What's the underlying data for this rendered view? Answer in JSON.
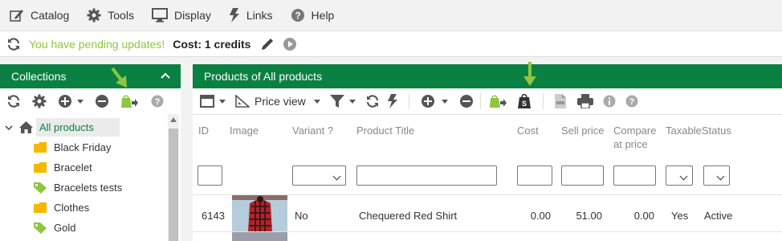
{
  "menu": {
    "catalog": "Catalog",
    "tools": "Tools",
    "display": "Display",
    "links": "Links",
    "help": "Help"
  },
  "update_bar": {
    "message": "You have pending updates!",
    "cost": "Cost: 1 credits"
  },
  "collections": {
    "title": "Collections",
    "items": [
      {
        "label": "All products",
        "icon": "home-icon"
      },
      {
        "label": "Black Friday",
        "icon": "folder-icon"
      },
      {
        "label": "Bracelet",
        "icon": "folder-icon"
      },
      {
        "label": "Bracelets tests",
        "icon": "tag-icon"
      },
      {
        "label": "Clothes",
        "icon": "folder-icon"
      },
      {
        "label": "Gold",
        "icon": "tag-icon"
      }
    ]
  },
  "products": {
    "title": "Products of All products",
    "price_view": "Price view",
    "columns": {
      "id": "ID",
      "image": "Image",
      "variant": "Variant ?",
      "title": "Product Title",
      "cost": "Cost",
      "sell_price": "Sell price",
      "compare_at_price_1": "Compare",
      "compare_at_price_2": "at price",
      "taxable": "Taxable",
      "status": "Status"
    },
    "rows": [
      {
        "id": "6143",
        "variant": "No",
        "title": "Chequered Red Shirt",
        "cost": "0.00",
        "sell_price": "51.00",
        "compare_at_price": "0.00",
        "taxable": "Yes",
        "status": "Active"
      }
    ]
  },
  "colors": {
    "header_green": "#0b8043",
    "update_green": "#8dc63f",
    "highlight_arrow": "#8dc63f",
    "folder_yellow": "#f5b800",
    "tag_green": "#8dc63f"
  }
}
